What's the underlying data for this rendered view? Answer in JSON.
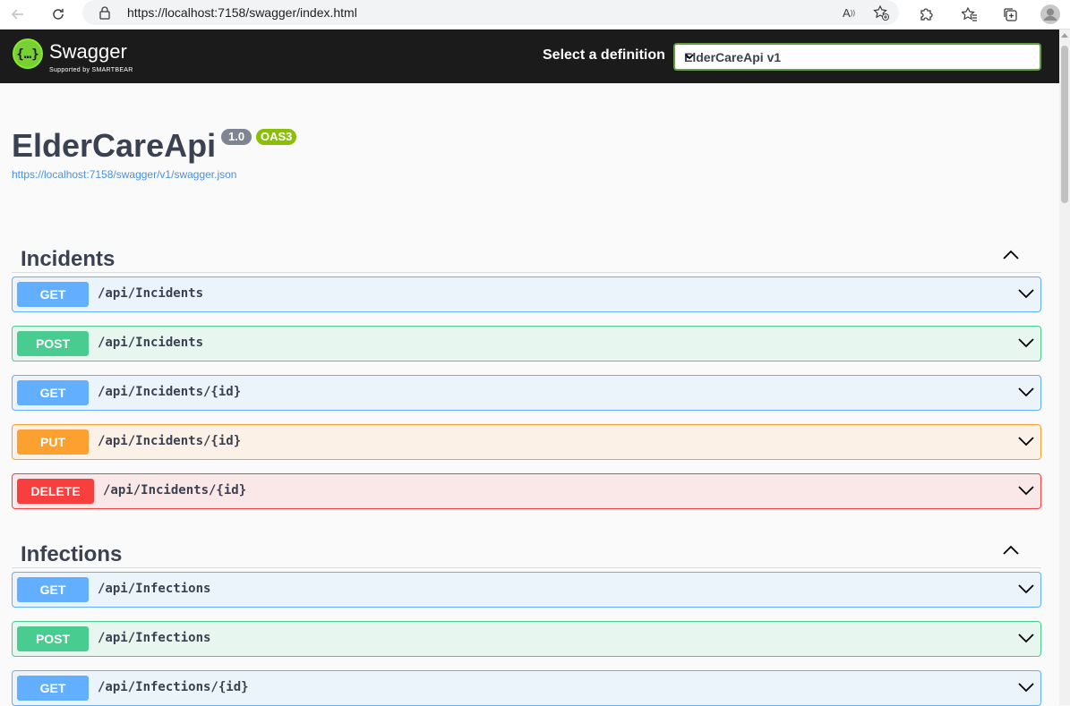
{
  "browser": {
    "url": "https://localhost:7158/swagger/index.html"
  },
  "topbar": {
    "brand": "Swagger",
    "brand_sub": "Supported by SMARTBEAR",
    "definition_label": "Select a definition",
    "definition_selected": "ElderCareApi v1"
  },
  "info": {
    "title": "ElderCareApi",
    "version": "1.0",
    "oas": "OAS3",
    "spec_url": "https://localhost:7158/swagger/v1/swagger.json"
  },
  "tags": [
    {
      "name": "Incidents",
      "operations": [
        {
          "method": "GET",
          "path": "/api/Incidents"
        },
        {
          "method": "POST",
          "path": "/api/Incidents"
        },
        {
          "method": "GET",
          "path": "/api/Incidents/{id}"
        },
        {
          "method": "PUT",
          "path": "/api/Incidents/{id}"
        },
        {
          "method": "DELETE",
          "path": "/api/Incidents/{id}"
        }
      ]
    },
    {
      "name": "Infections",
      "operations": [
        {
          "method": "GET",
          "path": "/api/Infections"
        },
        {
          "method": "POST",
          "path": "/api/Infections"
        },
        {
          "method": "GET",
          "path": "/api/Infections/{id}"
        }
      ]
    }
  ],
  "colors": {
    "get": "#61affe",
    "post": "#49cc90",
    "put": "#fca130",
    "delete": "#f93e3e"
  }
}
